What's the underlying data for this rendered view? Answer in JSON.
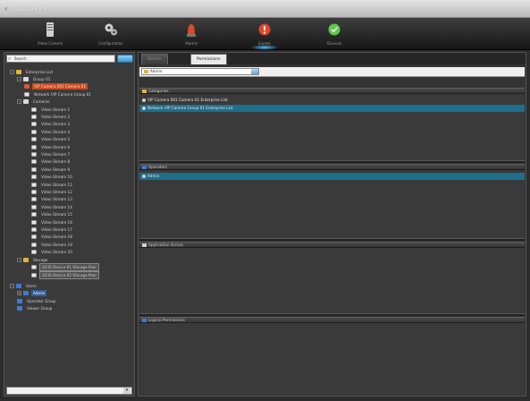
{
  "window": {
    "title": "BOSCH VMS"
  },
  "toolbar": {
    "buttons": [
      {
        "label": "Video Camera",
        "color": "#cfcfcf"
      },
      {
        "label": "Configuration",
        "color": "#cfcfcf"
      },
      {
        "label": "Alarms",
        "color": "#d94a2a"
      },
      {
        "label": "Events",
        "color": "#e0462b"
      },
      {
        "label": "Devices",
        "color": "#5ec94a"
      }
    ],
    "active_index": 3
  },
  "tree": {
    "search_placeholder": "Search",
    "footer_value": "",
    "nodes": [
      {
        "label": "Enterprise List",
        "icon": "folder",
        "expander": "−",
        "indent": 0
      },
      {
        "label": "Group 01",
        "icon": "group",
        "expander": "−",
        "indent": 1
      },
      {
        "label": "VIP Camera 001 Camera 01",
        "icon": "red",
        "expander": "",
        "indent": 2,
        "state": "sel"
      },
      {
        "label": "Network VIP Camera Group 01",
        "icon": "cam",
        "expander": "",
        "indent": 2
      },
      {
        "label": "Cameras",
        "icon": "group",
        "expander": "−",
        "indent": 1
      },
      {
        "label": "Video Stream 1",
        "icon": "cam",
        "expander": "",
        "indent": 3
      },
      {
        "label": "Video Stream 2",
        "icon": "cam",
        "expander": "",
        "indent": 3
      },
      {
        "label": "Video Stream 3",
        "icon": "cam",
        "expander": "",
        "indent": 3
      },
      {
        "label": "Video Stream 4",
        "icon": "cam",
        "expander": "",
        "indent": 3
      },
      {
        "label": "Video Stream 5",
        "icon": "cam",
        "expander": "",
        "indent": 3
      },
      {
        "label": "Video Stream 6",
        "icon": "cam",
        "expander": "",
        "indent": 3
      },
      {
        "label": "Video Stream 7",
        "icon": "cam",
        "expander": "",
        "indent": 3
      },
      {
        "label": "Video Stream 8",
        "icon": "cam",
        "expander": "",
        "indent": 3
      },
      {
        "label": "Video Stream 9",
        "icon": "cam",
        "expander": "",
        "indent": 3
      },
      {
        "label": "Video Stream 10",
        "icon": "cam",
        "expander": "",
        "indent": 3
      },
      {
        "label": "Video Stream 11",
        "icon": "cam",
        "expander": "",
        "indent": 3
      },
      {
        "label": "Video Stream 12",
        "icon": "cam",
        "expander": "",
        "indent": 3
      },
      {
        "label": "Video Stream 13",
        "icon": "cam",
        "expander": "",
        "indent": 3
      },
      {
        "label": "Video Stream 14",
        "icon": "cam",
        "expander": "",
        "indent": 3
      },
      {
        "label": "Video Stream 15",
        "icon": "cam",
        "expander": "",
        "indent": 3
      },
      {
        "label": "Video Stream 16",
        "icon": "cam",
        "expander": "",
        "indent": 3
      },
      {
        "label": "Video Stream 17",
        "icon": "cam",
        "expander": "",
        "indent": 3
      },
      {
        "label": "Video Stream 18",
        "icon": "cam",
        "expander": "",
        "indent": 3
      },
      {
        "label": "Video Stream 19",
        "icon": "cam",
        "expander": "",
        "indent": 3
      },
      {
        "label": "Video Stream 20",
        "icon": "cam",
        "expander": "",
        "indent": 3
      },
      {
        "label": "Storage",
        "icon": "folder",
        "expander": "−",
        "indent": 1
      },
      {
        "label": "iSCSI Device 01 Storage Pool",
        "icon": "cam",
        "expander": "",
        "indent": 3,
        "state": "boxed"
      },
      {
        "label": "iSCSI Device 02 Storage Pool",
        "icon": "cam",
        "expander": "",
        "indent": 3,
        "state": "boxed"
      },
      {
        "label": "Users",
        "icon": "blue",
        "expander": "−",
        "indent": 0
      },
      {
        "label": "Admin",
        "icon": "blue",
        "expander": "+",
        "indent": 1,
        "state": "hl"
      },
      {
        "label": "Operator Group",
        "icon": "blue",
        "expander": "",
        "indent": 1
      },
      {
        "label": "Viewer Group",
        "icon": "blue",
        "expander": "",
        "indent": 1
      }
    ]
  },
  "tabs": [
    {
      "label": "Details"
    },
    {
      "label": "Permissions"
    }
  ],
  "active_tab": 1,
  "combo_value": "Admin",
  "sections": [
    {
      "title": "Categories",
      "icon_color": "#e2b43a",
      "rows": [
        {
          "label": "VIP Camera 001 Camera 01 Enterprise List",
          "selected": false
        },
        {
          "label": "Network VIP Camera Group 01 Enterprise List",
          "selected": true
        }
      ]
    },
    {
      "title": "Operators",
      "icon_color": "#3f7bd3",
      "rows": [
        {
          "label": "Admin",
          "selected": true
        }
      ]
    },
    {
      "title": "Application Access",
      "icon_color": "#d0d0d0",
      "rows": []
    },
    {
      "title": "Logical Permissions",
      "icon_color": "#3f7bd3",
      "rows": []
    }
  ]
}
